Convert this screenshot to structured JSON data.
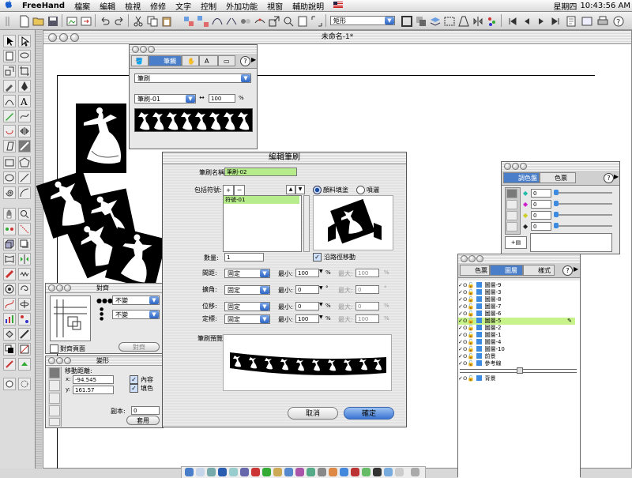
{
  "menubar": {
    "apple": "",
    "app_name": "FreeHand",
    "items": [
      "檔案",
      "編輯",
      "檢視",
      "修修",
      "文字",
      "控制",
      "外加功能",
      "視窗",
      "輔助說明"
    ],
    "day": "星期四",
    "time": "10:43:56 AM"
  },
  "main_toolbar": {
    "style_select": "矩形"
  },
  "document": {
    "title": "未命名-1*"
  },
  "brush_palette": {
    "tabs": [
      "筆觸",
      "A",
      ""
    ],
    "stroke_type": "筆刷",
    "brush_name": "筆刷-01",
    "width_value": "100",
    "width_unit": "%"
  },
  "edit_brush_dialog": {
    "title": "編輯筆刷",
    "brush_name_label": "筆刷名稱:",
    "brush_name_value": "筆刷-02",
    "include_label": "包括符號:",
    "symbol_item": "符號-01",
    "radio_paint": "顏料填塗",
    "radio_spray": "噴灑",
    "count_label": "數量:",
    "count_value": "1",
    "orient_label": "沿路徑移動",
    "rows": [
      {
        "label": "間距:",
        "mode": "固定",
        "min_label": "最小:",
        "min": "100",
        "min_unit": "%",
        "max_label": "最大:",
        "max": "100",
        "max_unit": "%"
      },
      {
        "label": "擴角:",
        "mode": "固定",
        "min_label": "最小:",
        "min": "0",
        "min_unit": "°",
        "max_label": "最大:",
        "max": "0",
        "max_unit": "°"
      },
      {
        "label": "位移:",
        "mode": "固定",
        "min_label": "最小:",
        "min": "0",
        "min_unit": "%",
        "max_label": "最大:",
        "max": "0",
        "max_unit": "%"
      },
      {
        "label": "定標:",
        "mode": "固定",
        "min_label": "最小:",
        "min": "100",
        "min_unit": "%",
        "max_label": "最大:",
        "max": "100",
        "max_unit": "%"
      }
    ],
    "preview_label": "筆刷預覽:",
    "cancel": "取消",
    "ok": "確定"
  },
  "align_palette": {
    "title": "對齊",
    "h_select": "不變",
    "v_select": "不變",
    "align_page_label": "對齊頁面",
    "align_button": "對齊"
  },
  "transform_palette": {
    "title": "變形",
    "move_distance_label": "移動距離:",
    "x_label": "x:",
    "x_value": "-94.545",
    "y_label": "y:",
    "y_value": "161.57",
    "contents_label": "內容",
    "fill_label": "填色",
    "copies_label": "副本:",
    "copies_value": "0",
    "apply_button": "套用"
  },
  "mixer_palette": {
    "tabs": [
      "調色盤",
      "色票"
    ],
    "values": [
      "0",
      "0",
      "0",
      "0"
    ]
  },
  "layers_palette": {
    "tabs": [
      "色票",
      "圖層",
      "樣式"
    ],
    "layers": [
      {
        "name": "圖層-9",
        "selected": false
      },
      {
        "name": "圖層-3",
        "selected": false
      },
      {
        "name": "圖層-8",
        "selected": false
      },
      {
        "name": "圖層-7",
        "selected": false
      },
      {
        "name": "圖層-6",
        "selected": false
      },
      {
        "name": "圖層-5",
        "selected": true
      },
      {
        "name": "圖層-2",
        "selected": false
      },
      {
        "name": "圖層-1",
        "selected": false
      },
      {
        "name": "圖層-4",
        "selected": false
      },
      {
        "name": "圖層-10",
        "selected": false
      },
      {
        "name": "前景",
        "selected": false
      },
      {
        "name": "參考線",
        "selected": false
      }
    ],
    "background_layer": "背景"
  },
  "colors": {
    "accent_blue": "#3a74d2",
    "selection_green": "#c8f28a",
    "swatch_blue": "#3c8be0"
  }
}
